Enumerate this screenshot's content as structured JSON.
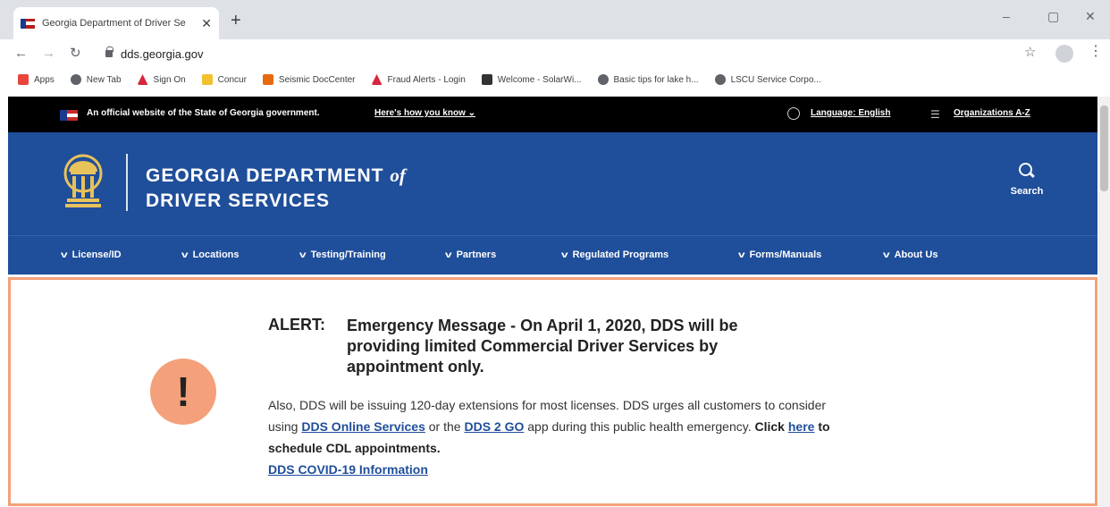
{
  "browser": {
    "tab_title": "Georgia Department of Driver Se",
    "tab_close": "✕",
    "new_tab": "+",
    "url": "dds.georgia.gov",
    "window_controls": [
      "–",
      "▢",
      "✕"
    ],
    "bookmarks": [
      {
        "label": "Apps",
        "icon": "apps-grid-icon",
        "color": "#e8453c"
      },
      {
        "label": "New Tab",
        "icon": "globe-icon",
        "color": "#5f6368"
      },
      {
        "label": "Sign On",
        "icon": "triangle-logo-icon",
        "color": "#d7263d"
      },
      {
        "label": "Concur",
        "icon": "concur-icon",
        "color": "#f2c12e"
      },
      {
        "label": "Seismic DocCenter",
        "icon": "seismic-icon",
        "color": "#e86a10"
      },
      {
        "label": "Fraud Alerts - Login",
        "icon": "triangle-logo-icon",
        "color": "#d7263d"
      },
      {
        "label": "Welcome - SolarWi...",
        "icon": "solarwinds-icon",
        "color": "#333333"
      },
      {
        "label": "Basic tips for lake h...",
        "icon": "globe-icon",
        "color": "#5f6368"
      },
      {
        "label": "LSCU Service Corpo...",
        "icon": "globe-icon",
        "color": "#5f6368"
      }
    ]
  },
  "official_banner": {
    "message": "An official website of the State of Georgia government.",
    "how_you_know": "Here's how you know",
    "language": "Language: English",
    "organizations": "Organizations A-Z"
  },
  "header": {
    "brand_line1": "GEORGIA DEPARTMENT ",
    "brand_of": "of",
    "brand_line2": "DRIVER SERVICES",
    "search_label": "Search"
  },
  "nav": {
    "items": [
      "License/ID",
      "Locations",
      "Testing/Training",
      "Partners",
      "Regulated Programs",
      "Forms/Manuals",
      "About Us"
    ]
  },
  "alert": {
    "icon_glyph": "!",
    "label": "ALERT:",
    "title": "Emergency Message - On April 1, 2020, DDS will be providing limited Commercial Driver Services by appointment only.",
    "body_1": "Also, DDS will be issuing 120-day extensions for most licenses. DDS urges all customers to consider using ",
    "link_online": "DDS Online Services",
    "body_2": " or the ",
    "link_2go": "DDS 2 GO",
    "body_3": " app during this public health emergency. ",
    "click": "Click ",
    "link_here": "here",
    "body_4": " to schedule CDL appointments.",
    "link_covid": "DDS COVID-19 Information"
  },
  "colors": {
    "brand_blue": "#1f4e9a",
    "alert_accent": "#f4a07a",
    "banner_black": "#000000"
  }
}
